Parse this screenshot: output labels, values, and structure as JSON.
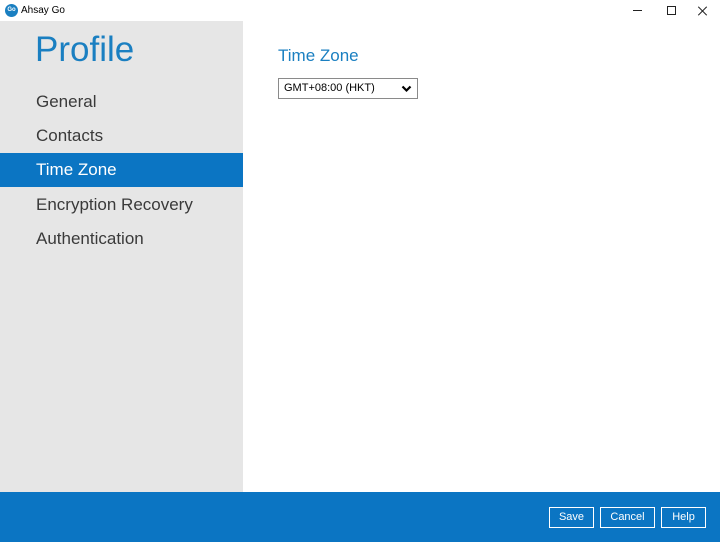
{
  "window": {
    "app_title": "Ahsay Go",
    "logo_text": "Go",
    "controls": {
      "minimize_icon": "minimize-icon",
      "maximize_icon": "maximize-icon",
      "close_icon": "close-icon"
    }
  },
  "sidebar": {
    "heading": "Profile",
    "items": [
      {
        "label": "General",
        "active": false
      },
      {
        "label": "Contacts",
        "active": false
      },
      {
        "label": "Time Zone",
        "active": true
      },
      {
        "label": "Encryption Recovery",
        "active": false
      },
      {
        "label": "Authentication",
        "active": false
      }
    ]
  },
  "main": {
    "section_title": "Time Zone",
    "timezone": {
      "selected": "GMT+08:00 (HKT)",
      "icon": "chevron-down-icon"
    }
  },
  "footer": {
    "save_label": "Save",
    "cancel_label": "Cancel",
    "help_label": "Help"
  },
  "colors": {
    "accent": "#0b75c3",
    "heading_blue": "#1a7fc1",
    "sidebar_bg": "#e6e6e6"
  }
}
